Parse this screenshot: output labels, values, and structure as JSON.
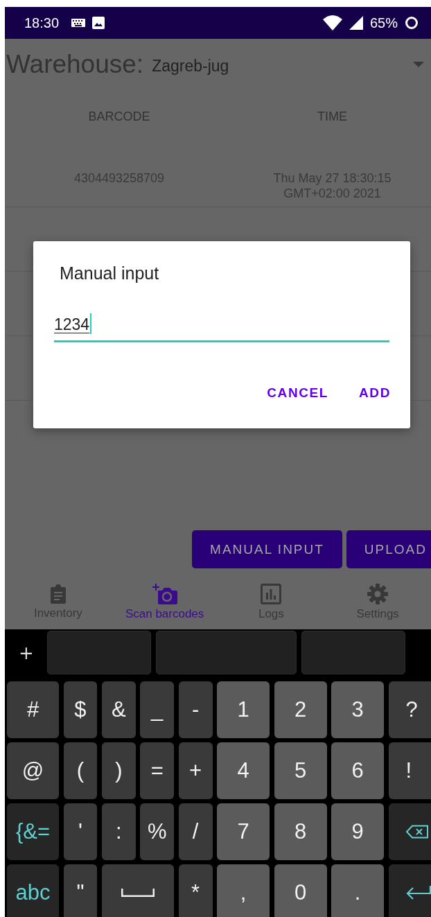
{
  "status_bar": {
    "time": "18:30",
    "battery": "65%"
  },
  "warehouse": {
    "label": "Warehouse:",
    "value": "Zagreb-jug"
  },
  "table": {
    "columns": [
      "BARCODE",
      "TIME"
    ],
    "rows": [
      {
        "barcode": "4304493258709",
        "time": "Thu May 27 18:30:15 GMT+02:00 2021"
      }
    ]
  },
  "actions": [
    "MANUAL INPUT",
    "UPLOAD"
  ],
  "nav": {
    "items": [
      {
        "label": "Inventory",
        "kind": "clipboard",
        "selected": false
      },
      {
        "label": "Scan barcodes",
        "kind": "camera",
        "selected": true
      },
      {
        "label": "Logs",
        "kind": "chart",
        "selected": false
      },
      {
        "label": "Settings",
        "kind": "gear",
        "selected": false
      }
    ]
  },
  "dialog": {
    "title": "Manual input",
    "field": {
      "value": "1234"
    },
    "buttons": [
      "CANCEL",
      "ADD"
    ]
  },
  "keyboard": {
    "toolbar": "+",
    "rows": [
      {
        "keys": [
          {
            "label": "#",
            "kind": "symbol"
          },
          {
            "label": "$",
            "kind": "symbol"
          },
          {
            "label": "&",
            "kind": "symbol"
          },
          {
            "label": "_",
            "kind": "symbol"
          },
          {
            "label": "-",
            "kind": "symbol"
          },
          {
            "label": "1",
            "kind": "digit"
          },
          {
            "label": "2",
            "kind": "digit"
          },
          {
            "label": "3",
            "kind": "digit"
          },
          {
            "label": "?",
            "kind": "symbol"
          }
        ]
      },
      {
        "keys": [
          {
            "label": "@",
            "kind": "symbol"
          },
          {
            "label": "(",
            "kind": "symbol"
          },
          {
            "label": ")",
            "kind": "symbol"
          },
          {
            "label": "=",
            "kind": "symbol"
          },
          {
            "label": "+",
            "kind": "symbol"
          },
          {
            "label": "4",
            "kind": "digit"
          },
          {
            "label": "5",
            "kind": "digit"
          },
          {
            "label": "6",
            "kind": "digit"
          },
          {
            "label": "!",
            "kind": "symbol"
          }
        ]
      },
      {
        "keys": [
          {
            "label": "{&=",
            "kind": "mode"
          },
          {
            "label": "'",
            "kind": "symbol"
          },
          {
            "label": ":",
            "kind": "symbol"
          },
          {
            "label": "%",
            "kind": "symbol"
          },
          {
            "label": "/",
            "kind": "symbol"
          },
          {
            "label": "7",
            "kind": "digit"
          },
          {
            "label": "8",
            "kind": "digit"
          },
          {
            "label": "9",
            "kind": "digit"
          },
          {
            "kind": "backspace"
          }
        ]
      },
      {
        "keys": [
          {
            "label": "abc",
            "kind": "mode"
          },
          {
            "label": "\"",
            "kind": "symbol"
          },
          {
            "kind": "space"
          },
          {
            "label": "*",
            "kind": "symbol"
          },
          {
            "label": ",",
            "kind": "digit"
          },
          {
            "label": "0",
            "kind": "digit"
          },
          {
            "label": ".",
            "kind": "digit"
          },
          {
            "kind": "enter"
          }
        ]
      }
    ]
  }
}
